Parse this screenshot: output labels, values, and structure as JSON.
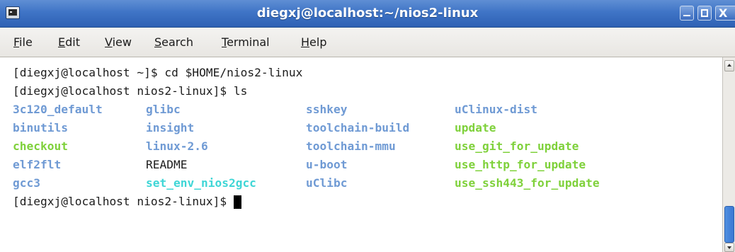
{
  "window": {
    "title": "diegxj@localhost:~/nios2-linux",
    "app_icon": "terminal-icon",
    "controls": [
      {
        "name": "minimize",
        "icon": "minimize-icon"
      },
      {
        "name": "maximize",
        "icon": "maximize-icon"
      },
      {
        "name": "close",
        "icon": "close-icon",
        "glyph": "X"
      }
    ],
    "title_bar_color": "#3f74c6"
  },
  "menubar": {
    "items": [
      {
        "mnemonic": "F",
        "rest": "ile"
      },
      {
        "mnemonic": "E",
        "rest": "dit"
      },
      {
        "mnemonic": "V",
        "rest": "iew"
      },
      {
        "mnemonic": "S",
        "rest": "earch"
      },
      {
        "mnemonic": "T",
        "rest": "erminal"
      },
      {
        "mnemonic": "H",
        "rest": "elp"
      }
    ]
  },
  "terminal": {
    "lines": [
      "[diegxj@localhost ~]$ cd $HOME/nios2-linux",
      "[diegxj@localhost nios2-linux]$ ls"
    ],
    "ls_columns": [
      [
        "3c120_default",
        "binutils",
        "checkout",
        "elf2flt",
        "gcc3"
      ],
      [
        "glibc",
        "insight",
        "linux-2.6",
        "README",
        "set_env_nios2gcc"
      ],
      [
        "sshkey",
        "toolchain-build",
        "toolchain-mmu",
        "u-boot",
        "uClibc"
      ],
      [
        "uClinux-dist",
        "update",
        "use_git_for_update",
        "use_http_for_update",
        "use_ssh443_for_update"
      ]
    ],
    "ls_colors": [
      [
        "blue",
        "blue",
        "green",
        "blue",
        "blue"
      ],
      [
        "blue",
        "blue",
        "blue",
        "plain",
        "cyan"
      ],
      [
        "blue",
        "blue",
        "blue",
        "blue",
        "blue"
      ],
      [
        "blue",
        "green",
        "green",
        "green",
        "green"
      ]
    ],
    "prompt": "[diegxj@localhost nios2-linux]$ ",
    "colors": {
      "directory": "#6f9ad4",
      "executable": "#7fd13b",
      "link": "#3fd6d6",
      "text": "#1c1c1c",
      "background": "#ffffff"
    }
  },
  "scrollbar": {
    "up_icon": "scroll-up-arrow-icon",
    "down_icon": "scroll-down-arrow-icon",
    "thumb_color": "#3b78d3"
  }
}
